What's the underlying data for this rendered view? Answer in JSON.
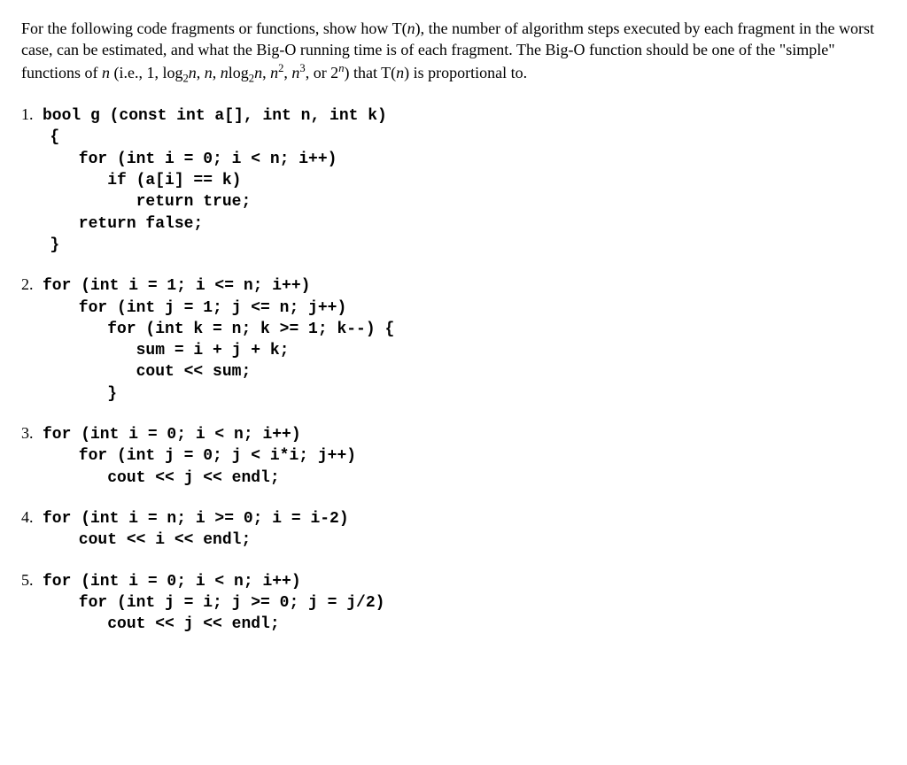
{
  "intro": {
    "part1": "For the following code fragments or functions, show how T(",
    "part2": "), the number of algorithm steps executed by each fragment in the worst case, can be estimated, and what the Big-O running time is of each fragment.  The Big-O function should be one of the \"simple\" functions of ",
    "part3": " (i.e., 1, log",
    "part4": ", ",
    "part5": ", ",
    "part6": "log",
    "part7": ", ",
    "part8": ", ",
    "part9": ", or 2",
    "part10": ") that T(",
    "part11": ") is proportional to.",
    "n": "n",
    "sub2": "2",
    "sup2": "2",
    "sup3": "3",
    "supn": "n"
  },
  "items": [
    {
      "num": "1.",
      "first": "bool g (const int a[], int n, int k)",
      "rest": "   {\n      for (int i = 0; i < n; i++)\n         if (a[i] == k)\n            return true;\n      return false;\n   }"
    },
    {
      "num": "2.",
      "first": "for (int i = 1; i <= n; i++)",
      "rest": "      for (int j = 1; j <= n; j++)\n         for (int k = n; k >= 1; k--) {\n            sum = i + j + k;\n            cout << sum;\n         }"
    },
    {
      "num": "3.",
      "first": "for (int i = 0; i < n; i++)",
      "rest": "      for (int j = 0; j < i*i; j++)\n         cout << j << endl;"
    },
    {
      "num": "4.",
      "first": "for (int i = n; i >= 0; i = i-2)",
      "rest": "      cout << i << endl;"
    },
    {
      "num": "5.",
      "first": "for (int i = 0; i < n; i++)",
      "rest": "      for (int j = i; j >= 0; j = j/2)\n         cout << j << endl;"
    }
  ]
}
